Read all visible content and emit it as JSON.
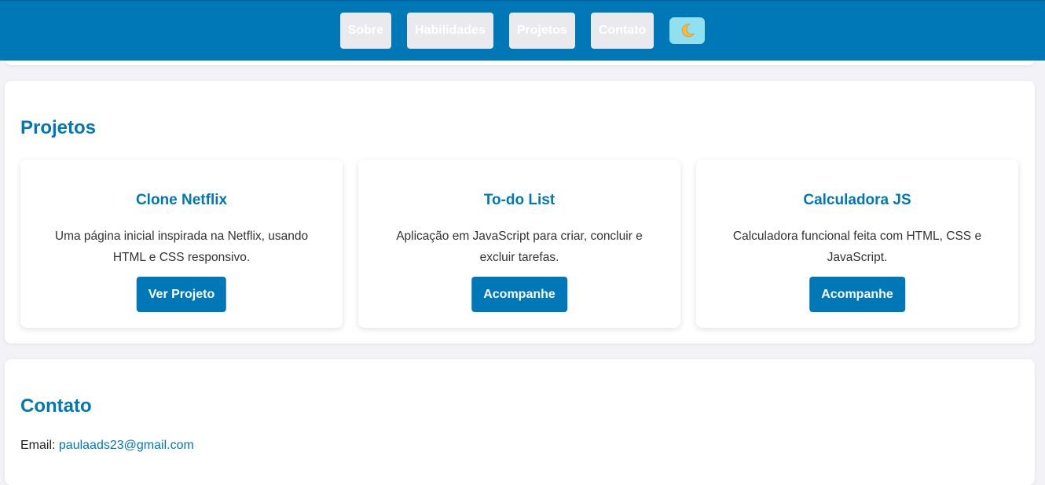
{
  "nav": {
    "items": [
      {
        "label": "Sobre"
      },
      {
        "label": "Habilidades"
      },
      {
        "label": "Projetos"
      },
      {
        "label": "Contato"
      }
    ],
    "theme_icon": "moon-icon"
  },
  "projects": {
    "title": "Projetos",
    "cards": [
      {
        "title": "Clone Netflix",
        "description": "Uma página inicial inspirada na Netflix, usando HTML e CSS responsivo.",
        "button": "Ver Projeto"
      },
      {
        "title": "To-do List",
        "description": "Aplicação em JavaScript para criar, concluir e excluir tarefas.",
        "button": "Acompanhe"
      },
      {
        "title": "Calculadora JS",
        "description": "Calculadora funcional feita com HTML, CSS e JavaScript.",
        "button": "Acompanhe"
      }
    ]
  },
  "contact": {
    "title": "Contato",
    "email_label": "Email:",
    "email": "paulaads23@gmail.com"
  },
  "colors": {
    "accent": "#0077b6",
    "nav_button_bg": "#e9e9ee",
    "theme_button_bg": "#90e0ef",
    "page_bg": "#f2f2f7"
  }
}
